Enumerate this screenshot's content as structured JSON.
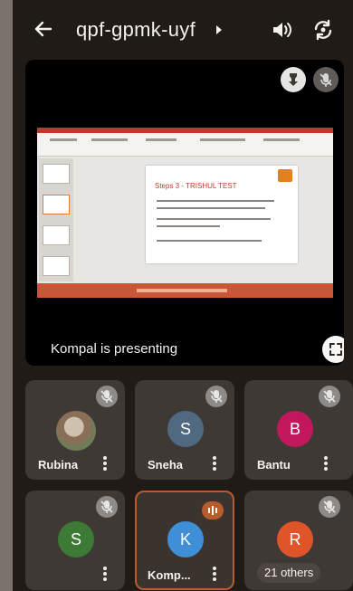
{
  "header": {
    "meeting_code": "qpf-gpmk-uyf"
  },
  "stage": {
    "presenter_label": "Kompal is presenting",
    "shared_slide": {
      "title": "Steps 3 - TRISHUL TEST"
    }
  },
  "participants": [
    {
      "name": "Rubina",
      "initial": "",
      "avatar_color": "#6f7d56",
      "muted": true
    },
    {
      "name": "Sneha",
      "initial": "S",
      "avatar_color": "#4f6a80",
      "muted": true
    },
    {
      "name": "Bantu",
      "initial": "B",
      "avatar_color": "#c2185b",
      "muted": true
    },
    {
      "name": "",
      "initial": "S",
      "avatar_color": "#3d7a35",
      "muted": true
    },
    {
      "name": "Komp...",
      "initial": "K",
      "avatar_color": "#3f8fd6",
      "speaking": true
    },
    {
      "name": "",
      "initial": "R",
      "avatar_color": "#e0542a",
      "muted": true,
      "others_label": "21 others"
    }
  ],
  "colors": {
    "background": "#201b17",
    "tile": "#3f3935",
    "speaking_accent": "#b85d2e"
  }
}
